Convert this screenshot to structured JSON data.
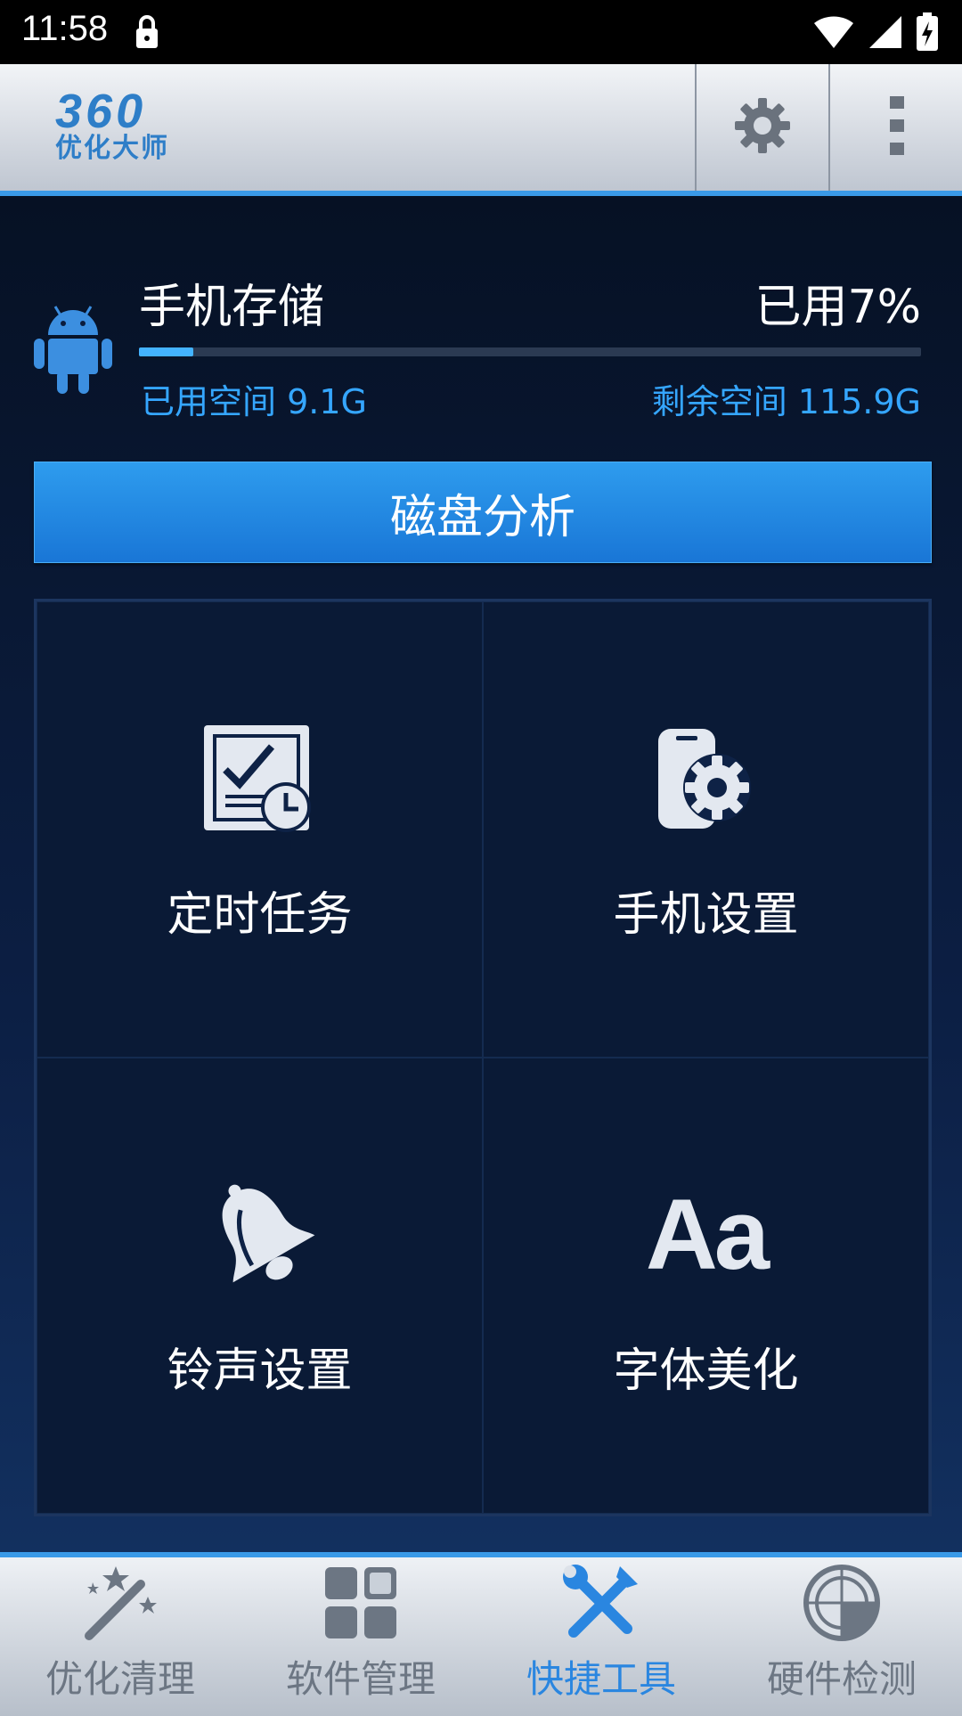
{
  "status_bar": {
    "time": "11:58"
  },
  "header": {
    "logo_number": "360",
    "logo_text": "优化大师",
    "settings_icon": "gear-icon",
    "more_icon": "overflow-menu-icon"
  },
  "storage": {
    "title": "手机存储",
    "used_percent_label": "已用7%",
    "used_fraction": 0.07,
    "used_space": "已用空间 9.1G",
    "free_space": "剩余空间 115.9G"
  },
  "disk_analysis_button": "磁盘分析",
  "tools": [
    {
      "label": "定时任务",
      "icon": "scheduled-task-icon"
    },
    {
      "label": "手机设置",
      "icon": "phone-settings-icon"
    },
    {
      "label": "铃声设置",
      "icon": "bell-icon"
    },
    {
      "label": "字体美化",
      "icon": "font-icon",
      "icon_text": "Aa"
    }
  ],
  "bottom_nav": [
    {
      "label": "优化清理",
      "icon": "magic-wand-icon",
      "active": false
    },
    {
      "label": "软件管理",
      "icon": "apps-grid-icon",
      "active": false
    },
    {
      "label": "快捷工具",
      "icon": "tools-icon",
      "active": true
    },
    {
      "label": "硬件检测",
      "icon": "radar-icon",
      "active": false
    }
  ],
  "colors": {
    "accent": "#2a86e0",
    "background": "#0b1d3d",
    "progress": "#43b3ff"
  }
}
